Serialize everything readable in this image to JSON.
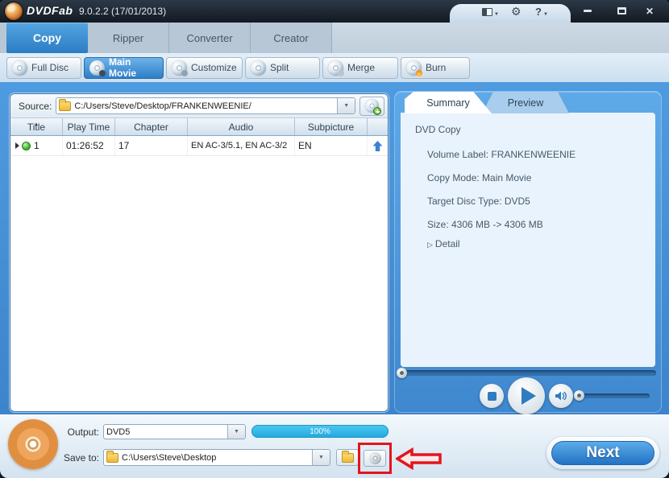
{
  "titlebar": {
    "app": "DVDFab",
    "version": "9.0.2.2 (17/01/2013)"
  },
  "tabs": {
    "copy": "Copy",
    "ripper": "Ripper",
    "converter": "Converter",
    "creator": "Creator"
  },
  "modes": {
    "full_disc": "Full Disc",
    "main_movie": "Main Movie",
    "customize": "Customize",
    "split": "Split",
    "merge": "Merge",
    "burn": "Burn"
  },
  "source": {
    "label": "Source:",
    "path": "C:/Users/Steve/Desktop/FRANKENWEENIE/"
  },
  "table": {
    "headers": {
      "title": "Title",
      "play_time": "Play Time",
      "chapter": "Chapter",
      "audio": "Audio",
      "subpicture": "Subpicture"
    },
    "row": {
      "title": "1",
      "play_time": "01:26:52",
      "chapter": "17",
      "audio": "EN AC-3/5.1, EN AC-3/2",
      "subpicture": "EN"
    }
  },
  "panel": {
    "tab_summary": "Summary",
    "tab_preview": "Preview",
    "heading": "DVD Copy",
    "volume_label": "Volume Label: FRANKENWEENIE",
    "copy_mode": "Copy Mode: Main Movie",
    "disc_type": "Target Disc Type: DVD5",
    "size": "Size: 4306 MB -> 4306 MB",
    "detail": "Detail"
  },
  "bottom": {
    "output_label": "Output:",
    "output_value": "DVD5",
    "progress": "100%",
    "save_label": "Save to:",
    "save_path": "C:\\Users\\Steve\\Desktop",
    "next": "Next"
  },
  "colors": {
    "accent_blue": "#2e7ec7",
    "progress_cyan": "#2fb6e6",
    "annotation_red": "#e2151c"
  }
}
